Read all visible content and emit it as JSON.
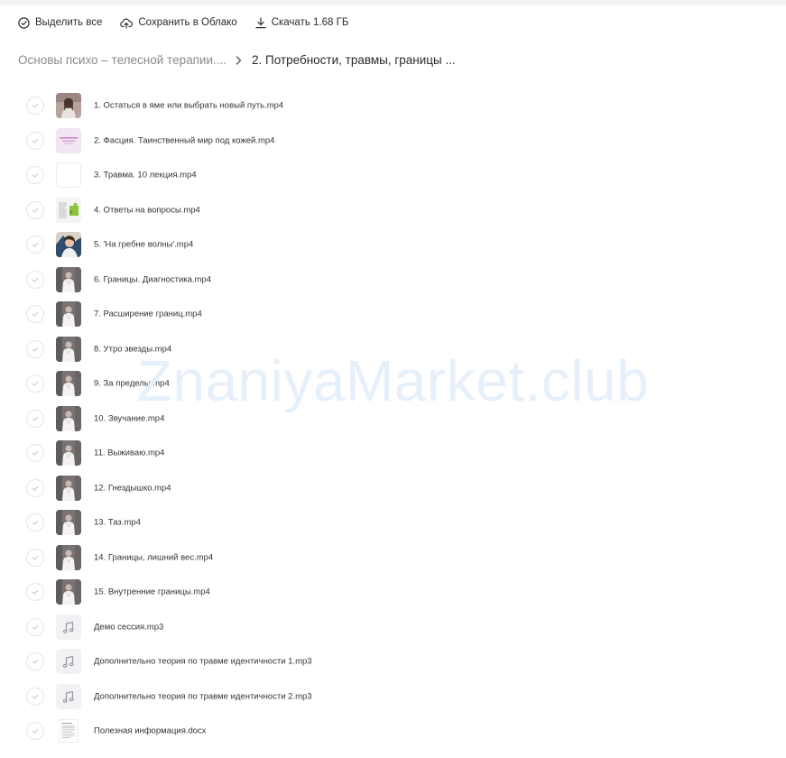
{
  "toolbar": {
    "select_all": "Выделить все",
    "save_cloud": "Сохранить в Облако",
    "download": "Скачать 1.68 ГБ"
  },
  "breadcrumb": {
    "parent": "Основы психо – телесной терапии....",
    "current": "2. Потребности, травмы, границы ..."
  },
  "files": [
    {
      "name": "1. Остаться в яме или выбрать новый путь.mp4",
      "thumb": "photo-woman"
    },
    {
      "name": "2. Фасция. Таинственный мир под кожей.mp4",
      "thumb": "pink-slide"
    },
    {
      "name": "3. Травма. 10 лекция.mp4",
      "thumb": "blank"
    },
    {
      "name": "4. Ответы на вопросы.mp4",
      "thumb": "puzzle"
    },
    {
      "name": "5. 'На гребне волны'.mp4",
      "thumb": "photo-portrait"
    },
    {
      "name": "6. Границы. Диагностика.mp4",
      "thumb": "video-person"
    },
    {
      "name": "7. Расширение границ.mp4",
      "thumb": "video-person"
    },
    {
      "name": "8. Утро звезды.mp4",
      "thumb": "video-person"
    },
    {
      "name": "9. За пределы.mp4",
      "thumb": "video-person"
    },
    {
      "name": "10. Звучание.mp4",
      "thumb": "video-person"
    },
    {
      "name": "11. Выживаю.mp4",
      "thumb": "video-person"
    },
    {
      "name": "12. Гнездышко.mp4",
      "thumb": "video-person"
    },
    {
      "name": "13. Таз.mp4",
      "thumb": "video-person"
    },
    {
      "name": "14. Границы, лишний вес.mp4",
      "thumb": "video-person"
    },
    {
      "name": "15. Внутренние границы.mp4",
      "thumb": "video-person"
    },
    {
      "name": "Демо сессия.mp3",
      "thumb": "audio"
    },
    {
      "name": "Дополнительно теория по травме идентичности 1.mp3",
      "thumb": "audio"
    },
    {
      "name": "Дополнительно теория по травме идентичности 2.mp3",
      "thumb": "audio"
    },
    {
      "name": "Полезная информация.docx",
      "thumb": "document"
    }
  ],
  "watermark": "ZnaniyaMarket.club",
  "colors": {
    "check_border": "#e6e6e8",
    "check_mark": "#c9c9cc",
    "muted_text": "#8a8a8a",
    "watermark": "#e6f0fb"
  }
}
